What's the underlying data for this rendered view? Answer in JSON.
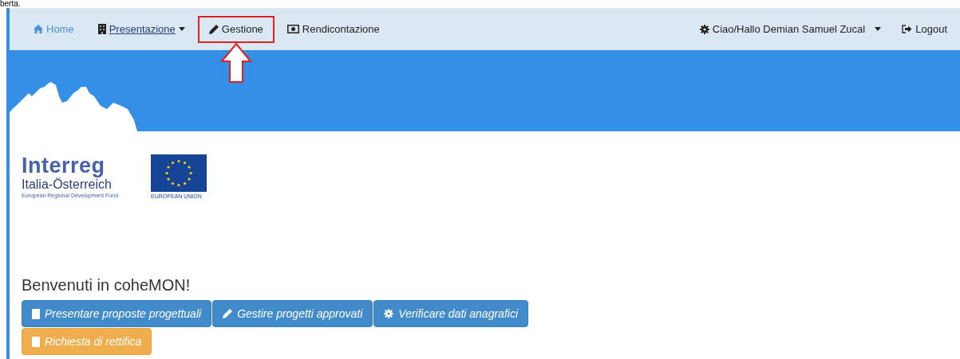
{
  "caption": "berta.",
  "nav": {
    "items": [
      {
        "label": "Home",
        "selected": true,
        "dropdown": false,
        "focused": false,
        "highlighted": false
      },
      {
        "label": "Presentazione",
        "selected": false,
        "dropdown": true,
        "focused": true,
        "highlighted": false
      },
      {
        "label": "Gestione",
        "selected": false,
        "dropdown": false,
        "focused": false,
        "highlighted": true
      },
      {
        "label": "Rendicontazione",
        "selected": false,
        "dropdown": false,
        "focused": false,
        "highlighted": false
      }
    ],
    "right": [
      {
        "label": "Ciao/Hallo Demian Samuel Zucal",
        "dropdown": true
      },
      {
        "label": "Logout",
        "dropdown": false
      }
    ]
  },
  "logo": {
    "name": "Interreg",
    "region": "Italia-Österreich",
    "fund": "European Regional Development Fund",
    "eu": "EUROPEAN UNION"
  },
  "heading": "Benvenuti in coheMON!",
  "buttons": [
    {
      "label": "Presentare proposte progettuali",
      "kind": "primary"
    },
    {
      "label": "Gestire progetti approvati",
      "kind": "primary"
    },
    {
      "label": "Verificare dati anagrafici",
      "kind": "primary"
    },
    {
      "label": "Richiesta di rettifica",
      "kind": "warning"
    }
  ]
}
